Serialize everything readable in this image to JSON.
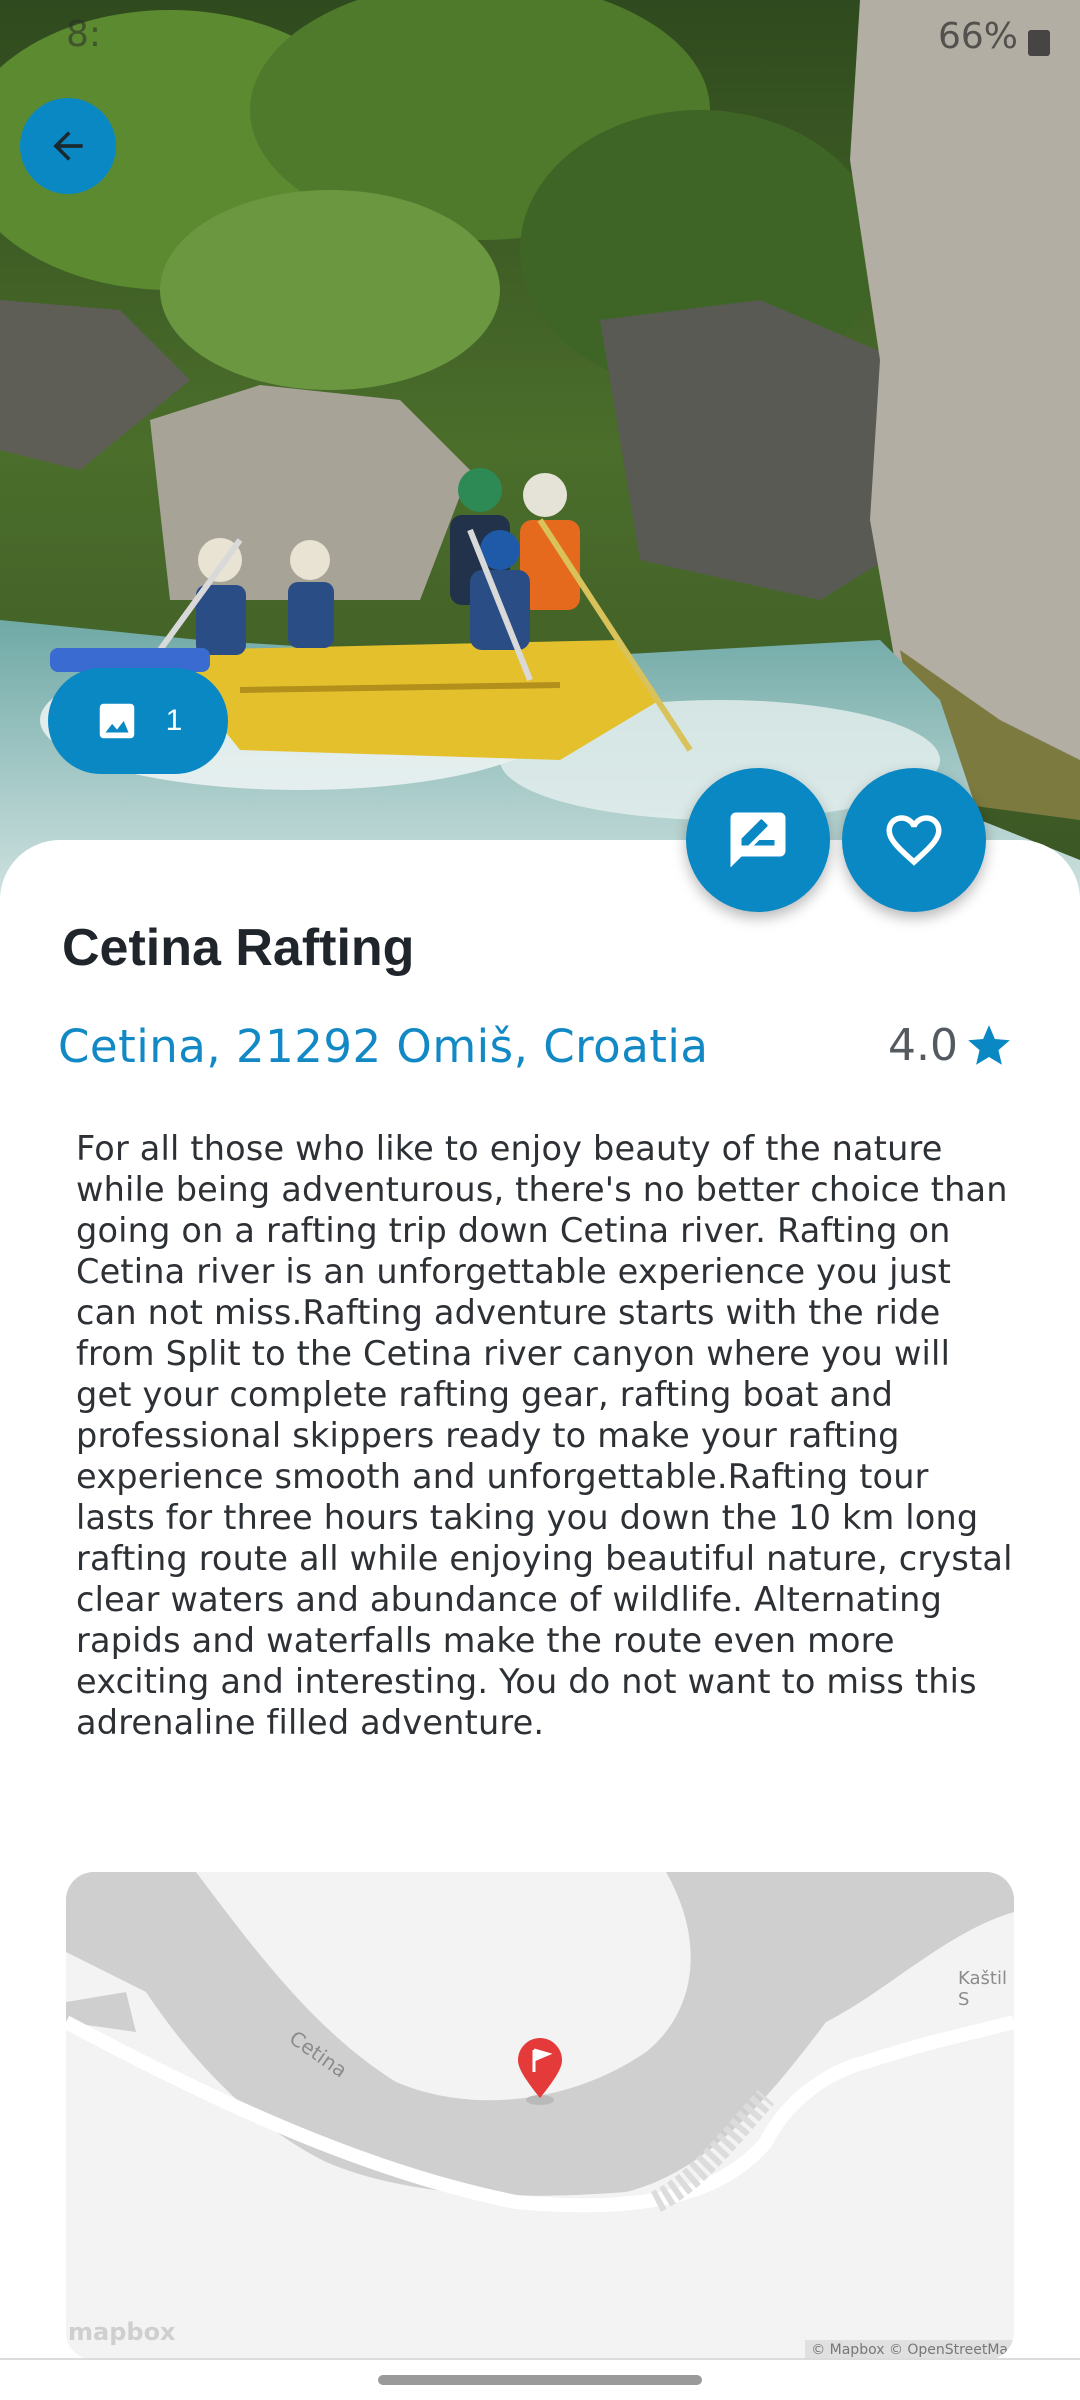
{
  "status_bar": {
    "time": "8:",
    "battery": "66%"
  },
  "place": {
    "title": "Cetina Rafting",
    "address": "Cetina, 21292 Omiš, Croatia",
    "rating": "4.0",
    "description": "For all those who like to enjoy beauty of the nature while being adventurous, there's no better choice than going on a rafting trip down Cetina river. Rafting on Cetina river is an unforgettable experience you just can not miss.Rafting adventure starts with the ride from Split to the Cetina river canyon where you will get your complete rafting gear, rafting boat and professional skippers ready to make your rafting experience smooth and unforgettable.Rafting tour lasts for three hours taking you down the 10 km long rafting route all while enjoying beautiful nature, crystal clear waters and abundance of wildlife. Alternating rapids and waterfalls make the route even more exciting and interesting. You do not want to miss this adrenaline filled adventure."
  },
  "gallery": {
    "count": "1"
  },
  "map": {
    "river_label": "Cetina",
    "place_label": "Kaštil S",
    "logo": "mapbox",
    "attribution": "© Mapbox © OpenStreetMa"
  },
  "icons": {
    "back": "arrow-left-icon",
    "gallery": "image-icon",
    "review": "rate-review-icon",
    "favorite": "heart-outline-icon",
    "rating": "star-icon",
    "map_pin": "flag-pin-icon"
  },
  "colors": {
    "accent": "#0a88c4",
    "address": "#1289c4",
    "title": "#1f252b",
    "text": "#2d3135"
  }
}
